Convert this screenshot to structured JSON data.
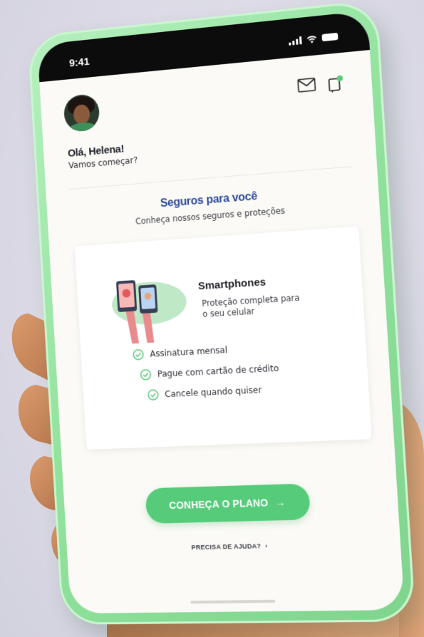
{
  "status_bar": {
    "time": "9:41"
  },
  "header": {
    "avatar_icon": "avatar-photo",
    "mail_icon": "envelope-icon",
    "notification_icon": "notification-icon"
  },
  "greeting": {
    "title": "Olá, Helena!",
    "subtitle": "Vamos começar?"
  },
  "section": {
    "title": "Seguros para você",
    "subtitle": "Conheça nossos seguros e proteções"
  },
  "card": {
    "title": "Smartphones",
    "description": "Proteção completa para o seu celular",
    "benefits": [
      "Assinatura mensal",
      "Pague com cartão de crédito",
      "Cancele quando quiser"
    ]
  },
  "cta": {
    "label": "CONHEÇA O PLANO",
    "arrow": "→"
  },
  "help": {
    "label": "PRECISA DE AJUDA?",
    "chevron": "›"
  },
  "colors": {
    "accent_green": "#56cc7b",
    "phone_frame": "#93e39f",
    "heading_blue": "#2f4a9c",
    "background": "#dcdbe6"
  }
}
